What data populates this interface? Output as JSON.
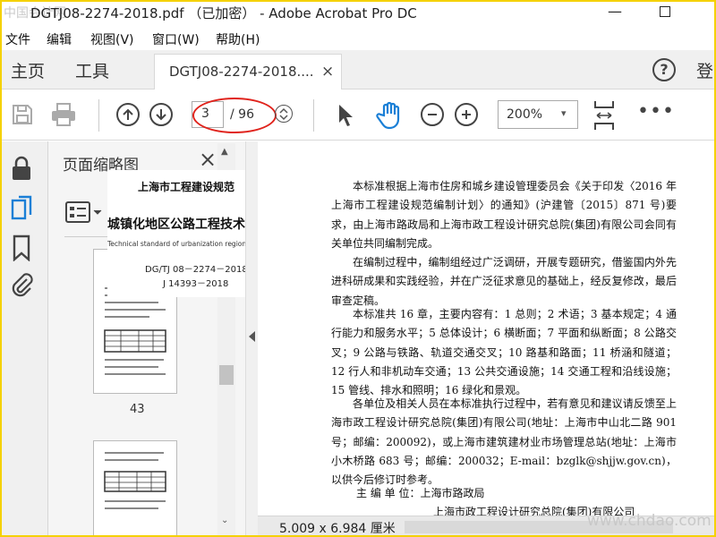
{
  "window": {
    "watermark_left": "中国会计网",
    "title": "DGTJ08-2274-2018.pdf （已加密） - Adobe Acrobat Pro DC",
    "minimize": "—"
  },
  "menu": [
    "文件",
    "编辑",
    "视图(V)",
    "窗口(W)",
    "帮助(H)"
  ],
  "tabs": {
    "home": "主页",
    "tools": "工具",
    "doc_tab": "DGTJ08-2274-2018....",
    "close": "×",
    "help": "?",
    "login": "登"
  },
  "toolbar": {
    "page_current": "3",
    "page_total": "/ 96",
    "zoom": "200%",
    "zoom_caret": "▾",
    "more": "•••",
    "icons": [
      "save-icon",
      "print-icon",
      "page-up-icon",
      "page-down-icon",
      "page-spin-icon",
      "select-arrow-icon",
      "hand-tool-icon",
      "zoom-out-icon",
      "zoom-in-icon",
      "fit-page-icon",
      "more-icon"
    ]
  },
  "rail_icons": [
    "lock-icon",
    "page-thumbnails-icon",
    "bookmark-icon",
    "attachment-icon"
  ],
  "thumbnails": {
    "title": "页面缩略图",
    "close": "×",
    "page_number": "43"
  },
  "cover": {
    "line1": "上海市工程建设规范",
    "line2": "城镇化地区公路工程技术标准",
    "line3": "Technical standard of urbanization regional highway engineering",
    "line4": "DG/TJ 08－2274－2018",
    "line5": "J 14393－2018"
  },
  "document": {
    "paragraphs": [
      "本标准根据上海市住房和城乡建设管理委员会《关于印发〈2016 年上海市工程建设规范编制计划〉的通知》(沪建管〔2015〕871 号)要求，由上海市路政局和上海市政工程设计研究总院(集团)有限公司会同有关单位共同编制完成。",
      "在编制过程中，编制组经过广泛调研，开展专题研究，借鉴国内外先进科研成果和实践经验，并在广泛征求意见的基础上，经反复修改，最后审查定稿。",
      "本标准共 16 章，主要内容有：1 总则；2 术语；3 基本规定；4 通行能力和服务水平；5 总体设计；6 横断面；7 平面和纵断面；8 公路交叉；9 公路与铁路、轨道交通交叉；10 路基和路面；11 桥涵和隧道；12 行人和非机动车交通；13 公共交通设施；14 交通工程和沿线设施；15 管线、排水和照明；16 绿化和景观。",
      "各单位及相关人员在本标准执行过程中，若有意见和建议请反馈至上海市政工程设计研究总院(集团)有限公司(地址：上海市中山北二路 901 号；邮编：200092)，或上海市建筑建材业市场管理总站(地址：上海市小木桥路 683 号；邮编：200032；E-mail：bzglk@shjjw.gov.cn)，以供今后修订时参考。"
    ],
    "sign_label": "主 编 单 位：上海市路政局",
    "sign_org2": "上海市政工程设计研究总院(集团)有限公司"
  },
  "status": {
    "page_size": "5.009 x 6.984 厘米",
    "watermark": "www.chdao.com"
  }
}
